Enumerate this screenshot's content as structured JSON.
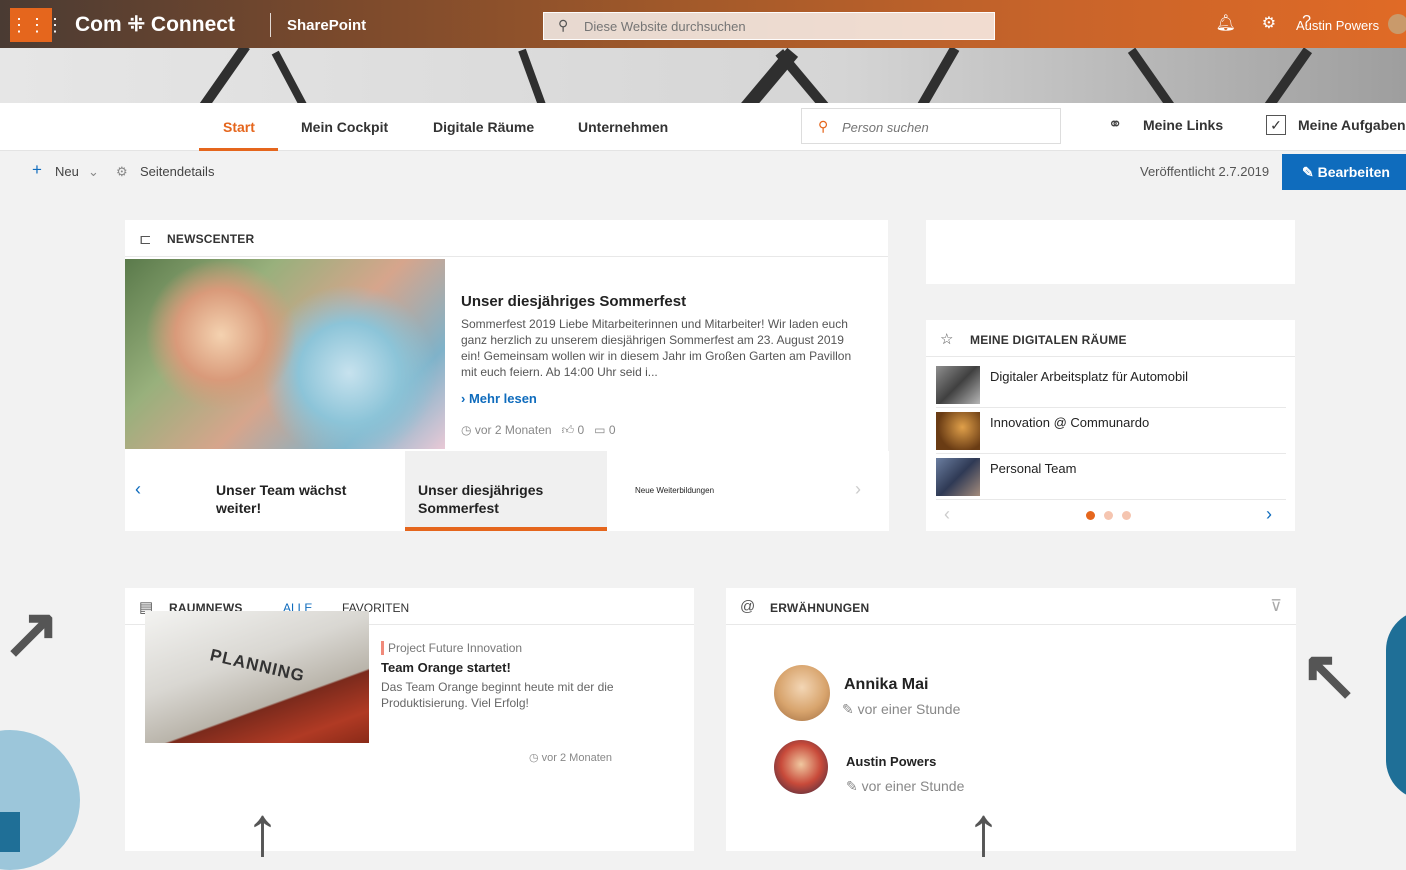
{
  "suite": {
    "brand": "Com ⁜ Connect",
    "product": "SharePoint",
    "search_placeholder": "Diese Website durchsuchen",
    "user_name": "Austin Powers"
  },
  "nav": {
    "items": [
      {
        "label": "Start",
        "active": true
      },
      {
        "label": "Mein Cockpit"
      },
      {
        "label": "Digitale Räume"
      },
      {
        "label": "Unternehmen"
      }
    ],
    "person_search_placeholder": "Person suchen",
    "my_links": "Meine Links",
    "my_tasks": "Meine Aufgaben"
  },
  "command_bar": {
    "new": "Neu",
    "page_details": "Seitendetails",
    "published": "Veröffentlicht 2.7.2019",
    "edit": "Bearbeiten"
  },
  "newscenter": {
    "title": "NEWSCENTER",
    "article": {
      "title": "Unser diesjähriges Sommerfest",
      "body": "Sommerfest 2019 Liebe Mitarbeiterinnen und Mitarbeiter! Wir laden euch ganz herzlich zu unserem diesjährigen Sommerfest am 23. August 2019 ein! Gemeinsam wollen wir in diesem Jahr im Großen Garten am Pavillon mit euch feiern. Ab 14:00 Uhr seid i...",
      "more": "Mehr lesen",
      "time": "vor 2 Monaten",
      "likes": "0",
      "comments": "0"
    },
    "carousel": [
      "Unser Team wächst weiter!",
      "Unser diesjähriges Sommerfest",
      "Neue Weiterbildungen"
    ]
  },
  "digital_rooms": {
    "title": "MEINE DIGITALEN RÄUME",
    "items": [
      {
        "label": "Digitaler Arbeitsplatz für Automobil"
      },
      {
        "label": "Innovation @ Communardo"
      },
      {
        "label": "Personal Team"
      }
    ]
  },
  "raumnews": {
    "title": "RAUMNEWS",
    "tabs": [
      "ALLE",
      "FAVORITEN"
    ],
    "item": {
      "image_text": "PLANNING",
      "room": "Project Future Innovation",
      "title": "Team Orange startet!",
      "body": "Das Team Orange beginnt heute mit der die Produktisierung. Viel Erfolg!",
      "time": "vor 2 Monaten"
    }
  },
  "mentions": {
    "title": "ERWÄHNUNGEN",
    "items": [
      {
        "name": "Annika Mai",
        "time": "vor einer Stunde"
      },
      {
        "name": "Austin Powers",
        "time": "vor einer Stunde"
      }
    ]
  },
  "colors": {
    "accent": "#e5661d",
    "primary": "#0f6cbd"
  }
}
